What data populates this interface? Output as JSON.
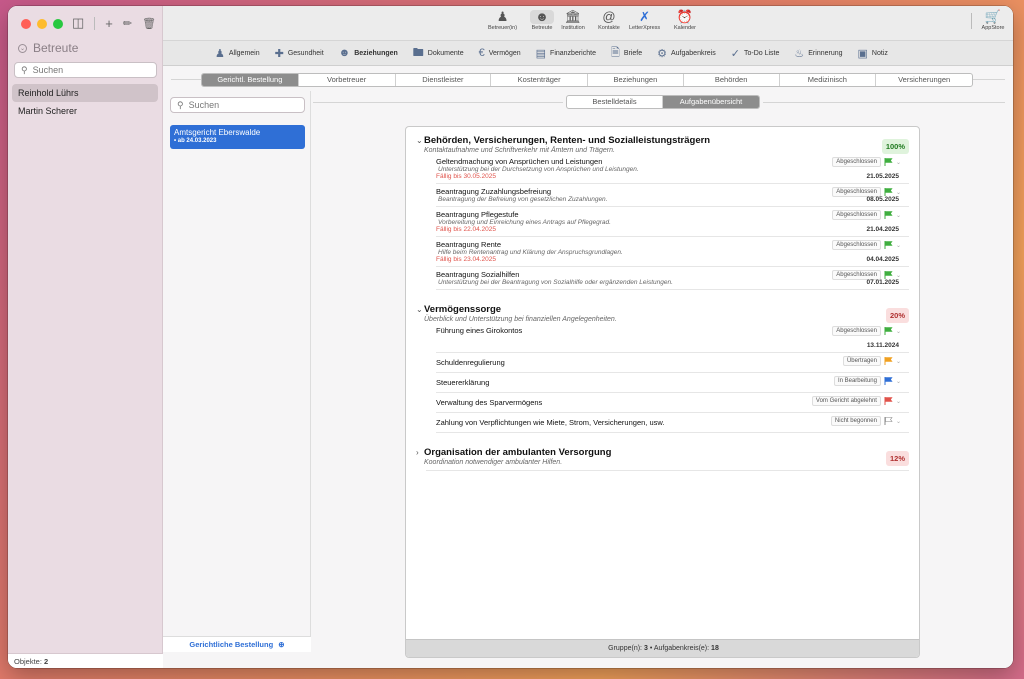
{
  "sidebar": {
    "title": "Betreute",
    "search_placeholder": "Suchen",
    "items": [
      {
        "label": "Reinhold Lührs",
        "selected": true
      },
      {
        "label": "Martin Scherer",
        "selected": false
      }
    ],
    "footer_label": "Objekte:",
    "footer_count": "2"
  },
  "toolbar": {
    "items": [
      {
        "label": "Betreuer(in)",
        "icon": "person-outline-icon"
      },
      {
        "label": "Betreute",
        "icon": "person-filled-icon",
        "active": true
      },
      {
        "label": "Institution",
        "icon": "building-icon"
      },
      {
        "label": "Kontakte",
        "icon": "at-icon"
      },
      {
        "label": "LetterXpress",
        "icon": "letterxpress-icon"
      },
      {
        "label": "Kalender",
        "icon": "alarm-clock-icon"
      }
    ],
    "appstore_label": "AppStore"
  },
  "nav": [
    {
      "label": "Allgemein",
      "icon": "person-icon"
    },
    {
      "label": "Gesundheit",
      "icon": "medical-kit-icon"
    },
    {
      "label": "Beziehungen",
      "icon": "people-icon",
      "active": true
    },
    {
      "label": "Dokumente",
      "icon": "folder-icon"
    },
    {
      "label": "Vermögen",
      "icon": "euro-icon"
    },
    {
      "label": "Finanzberichte",
      "icon": "chart-icon"
    },
    {
      "label": "Briefe",
      "icon": "document-icon"
    },
    {
      "label": "Aufgabenkreis",
      "icon": "task-icon"
    },
    {
      "label": "To-Do Liste",
      "icon": "checkmark-circle-icon"
    },
    {
      "label": "Erinnerung",
      "icon": "bell-icon"
    },
    {
      "label": "Notiz",
      "icon": "note-icon"
    }
  ],
  "tabs": [
    "Gerichtl. Bestellung",
    "Vorbetreuer",
    "Dienstleister",
    "Kostenträger",
    "Beziehungen",
    "Behörden",
    "Medizinisch",
    "Versicherungen"
  ],
  "list": {
    "search_placeholder": "Suchen",
    "card_title": "Amtsgericht Eberswalde",
    "card_date": "• ab 24.03.2023",
    "footer": "Gerichtliche Bestellung"
  },
  "subtabs": [
    "Bestelldetails",
    "Aufgabenübersicht"
  ],
  "groups": [
    {
      "title": "Behörden, Versicherungen, Renten- und Sozialleistungsträgern",
      "subtitle": "Kontaktaufnahme und Schriftverkehr mit Ämtern und Trägern.",
      "percent": "100%",
      "expanded": true,
      "tasks": [
        {
          "name": "Geltendmachung von Ansprüchen und Leistungen",
          "desc": "Unterstützung bei der Durchsetzung von Ansprüchen und Leistungen.",
          "due": "Fällig bis 30.05.2025",
          "status": "Abgeschlossen",
          "flag": "#3fae3f",
          "date": "21.05.2025"
        },
        {
          "name": "Beantragung Zuzahlungsbefreiung",
          "desc": "Beantragung der Befreiung von gesetzlichen Zuzahlungen.",
          "due": "",
          "status": "Abgeschlossen",
          "flag": "#3fae3f",
          "date": "08.05.2025"
        },
        {
          "name": "Beantragung Pflegestufe",
          "desc": "Vorbereitung und Einreichung eines Antrags auf Pflegegrad.",
          "due": "Fällig bis 22.04.2025",
          "status": "Abgeschlossen",
          "flag": "#3fae3f",
          "date": "21.04.2025"
        },
        {
          "name": "Beantragung Rente",
          "desc": "Hilfe beim Rentenantrag und Klärung der Anspruchsgrundlagen.",
          "due": "Fällig bis 23.04.2025",
          "status": "Abgeschlossen",
          "flag": "#3fae3f",
          "date": "04.04.2025"
        },
        {
          "name": "Beantragung Sozialhilfen",
          "desc": "Unterstützung bei der Beantragung von Sozialhilfe oder ergänzenden Leistungen.",
          "due": "",
          "status": "Abgeschlossen",
          "flag": "#3fae3f",
          "date": "07.01.2025"
        }
      ]
    },
    {
      "title": "Vermögenssorge",
      "subtitle": "Überblick und Unterstützung bei finanziellen Angelegenheiten.",
      "percent": "20%",
      "expanded": true,
      "tasks": [
        {
          "name": "Führung eines Girokontos",
          "desc": "",
          "due": "",
          "status": "Abgeschlossen",
          "flag": "#3fae3f",
          "date": "13.11.2024"
        },
        {
          "name": "Schuldenregulierung",
          "desc": "",
          "due": "",
          "status": "Übertragen",
          "flag": "#f0a020",
          "date": ""
        },
        {
          "name": "Steuererklärung",
          "desc": "",
          "due": "",
          "status": "In Bearbeitung",
          "flag": "#2f6fd6",
          "date": ""
        },
        {
          "name": "Verwaltung des Sparvermögens",
          "desc": "",
          "due": "",
          "status": "Vom Gericht abgelehnt",
          "flag": "#e0524a",
          "date": ""
        },
        {
          "name": "Zahlung von Verpflichtungen wie Miete, Strom, Versicherungen, usw.",
          "desc": "",
          "due": "",
          "status": "Nicht begonnen",
          "flag": "#ffffff",
          "date": ""
        }
      ]
    },
    {
      "title": "Organisation der ambulanten Versorgung",
      "subtitle": "Koordination notwendiger ambulanter Hilfen.",
      "percent": "12%",
      "expanded": false,
      "tasks": []
    }
  ],
  "panel_footer": {
    "groups_label": "Gruppe(n):",
    "groups_count": "3",
    "tasks_label": "Aufgabenkreis(e):",
    "tasks_count": "18"
  }
}
